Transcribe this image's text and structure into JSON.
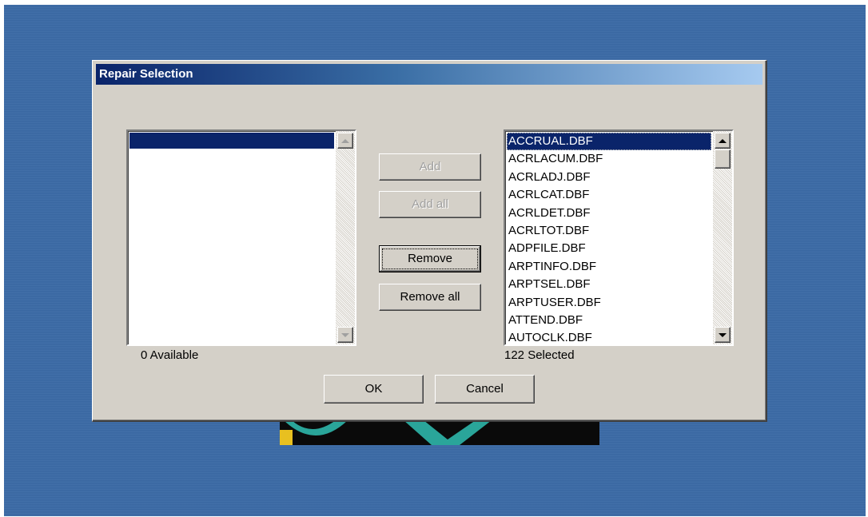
{
  "dialog": {
    "title": "Repair Selection"
  },
  "available": {
    "items": [],
    "count_label": "0 Available"
  },
  "selected": {
    "items": [
      "ACCRUAL.DBF",
      "ACRLACUM.DBF",
      "ACRLADJ.DBF",
      "ACRLCAT.DBF",
      "ACRLDET.DBF",
      "ACRLTOT.DBF",
      "ADPFILE.DBF",
      "ARPTINFO.DBF",
      "ARPTSEL.DBF",
      "ARPTUSER.DBF",
      "ATTEND.DBF",
      "AUTOCLK.DBF"
    ],
    "highlighted_item": "ACCRUAL.DBF",
    "count_label": "122 Selected"
  },
  "buttons": {
    "add": "Add",
    "add_all": "Add all",
    "remove": "Remove",
    "remove_all": "Remove all",
    "ok": "OK",
    "cancel": "Cancel"
  },
  "colors": {
    "desktop": "#3b6aa5",
    "dialog_face": "#d4d0c8",
    "selection": "#0a246a",
    "title_gradient_start": "#0a246a",
    "title_gradient_end": "#a6caf0"
  }
}
